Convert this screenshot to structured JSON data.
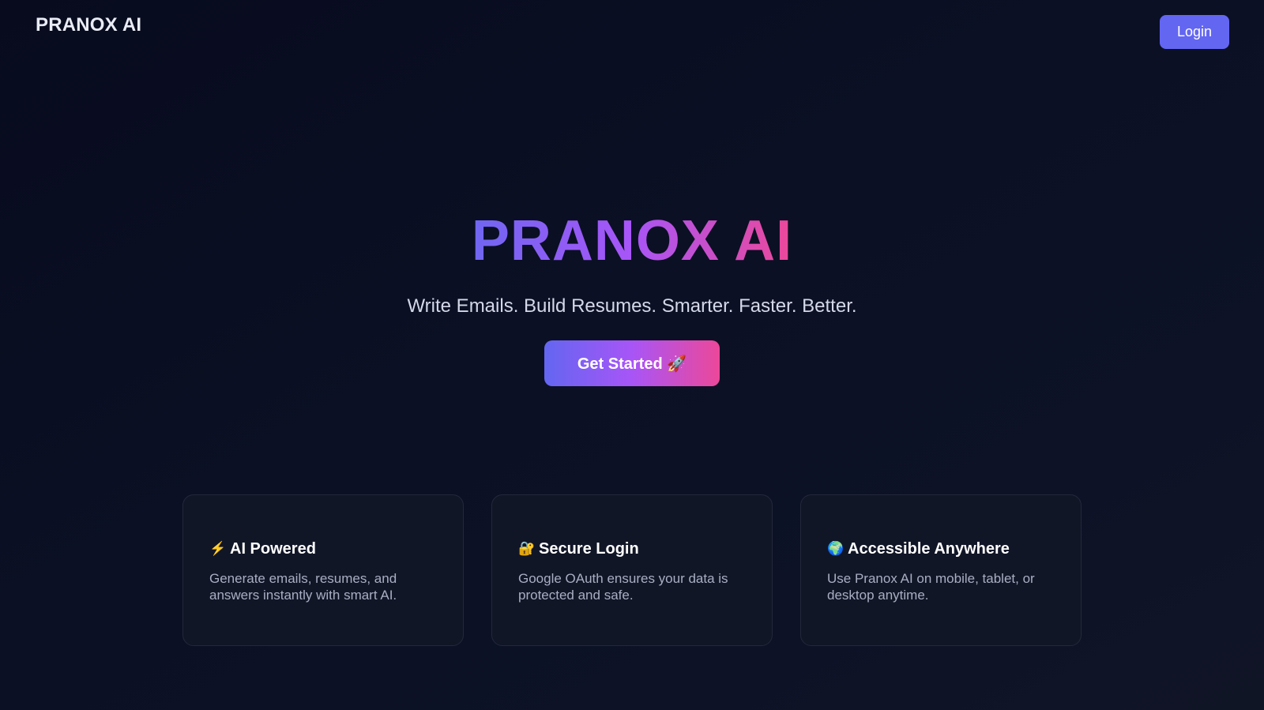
{
  "header": {
    "brand": "PRANOX AI",
    "login_label": "Login"
  },
  "hero": {
    "title": "PRANOX AI",
    "subtitle": "Write Emails. Build Resumes. Smarter. Faster. Better.",
    "cta_label": "Get Started 🚀"
  },
  "features": [
    {
      "icon": "⚡",
      "icon_name": "lightning-icon",
      "title": "AI Powered",
      "description": "Generate emails, resumes, and answers instantly with smart AI."
    },
    {
      "icon": "🔐",
      "icon_name": "lock-key-icon",
      "title": "Secure Login",
      "description": "Google OAuth ensures your data is protected and safe."
    },
    {
      "icon": "🌍",
      "icon_name": "globe-icon",
      "title": "Accessible Anywhere",
      "description": "Use Pranox AI on mobile, tablet, or desktop anytime."
    }
  ],
  "colors": {
    "accent": "#6366f1",
    "gradient_start": "#6366f1",
    "gradient_mid": "#a855f7",
    "gradient_end": "#ec4899",
    "background": "#0b1024",
    "card_background": "#111627"
  }
}
